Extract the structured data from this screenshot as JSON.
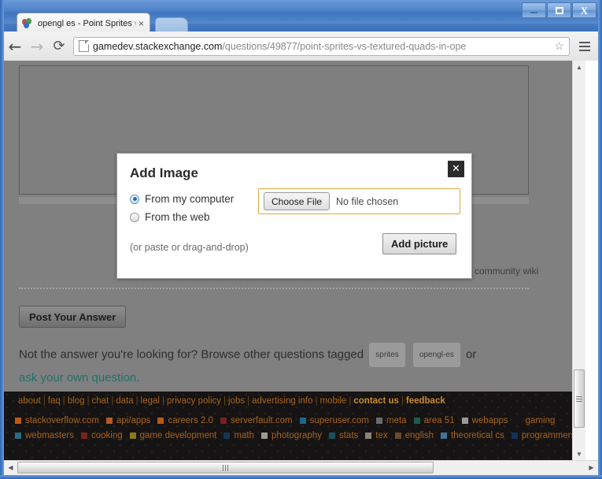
{
  "window": {
    "controls": {
      "minimize": "Minimize",
      "maximize": "Maximize",
      "close": "Close"
    }
  },
  "browser": {
    "tab": {
      "title_main": "opengl es - Point Sprites",
      "title_faded": "v",
      "close_label": "×",
      "favicon": "stack-exchange-balloons-icon"
    },
    "newtab_label": "New Tab",
    "toolbar": {
      "back_label": "←",
      "forward_label": "→",
      "reload_label": "⟳",
      "menu_label": "Menu",
      "star_label": "☆"
    },
    "omnibox": {
      "host": "gamedev.stackexchange.com",
      "path": "/questions/49877/point-sprites-vs-textured-quads-in-ope"
    }
  },
  "page": {
    "community_wiki": "community wiki",
    "post_answer_label": "Post Your Answer",
    "not_answer_prefix": "Not the answer you're looking for? Browse other questions tagged",
    "tags": [
      "sprites",
      "opengl-es"
    ],
    "or_word": "or",
    "ask_own_question": "ask your own question."
  },
  "modal": {
    "title": "Add Image",
    "close_label": "✕",
    "radio_computer": "From my computer",
    "radio_web": "From the web",
    "radio_selected": "From my computer",
    "choose_file_label": "Choose File",
    "no_file_text": "No file chosen",
    "hint": "(or paste or drag-and-drop)",
    "add_picture_label": "Add picture",
    "accent_border": "#e0a83f"
  },
  "footer": {
    "links": [
      "about",
      "faq",
      "blog",
      "chat",
      "data",
      "legal",
      "privacy policy",
      "jobs",
      "advertising info",
      "mobile",
      "contact us",
      "feedback"
    ],
    "bold_links": [
      "contact us",
      "feedback"
    ],
    "separator": "|",
    "sites_row1": [
      {
        "name": "stackoverflow.com",
        "color": "#b8581a"
      },
      {
        "name": "api/apps",
        "color": "#b8581a"
      },
      {
        "name": "careers 2.0",
        "color": "#b8581a"
      },
      {
        "name": "serverfault.com",
        "color": "#7a1f1f"
      },
      {
        "name": "superuser.com",
        "color": "#18698f"
      },
      {
        "name": "meta",
        "color": "#6a6a6a"
      },
      {
        "name": "area 51",
        "color": "#1d5c4c"
      },
      {
        "name": "webapps",
        "color": "#9a9a9a"
      },
      {
        "name": "gaming",
        "color": "transparent"
      }
    ],
    "sites_row2": [
      {
        "name": "webmasters",
        "color": "#2a6b82"
      },
      {
        "name": "cooking",
        "color": "#7a2218"
      },
      {
        "name": "game development",
        "color": "#8a7a1a"
      },
      {
        "name": "math",
        "color": "#15374f"
      },
      {
        "name": "photography",
        "color": "#a09a8f"
      },
      {
        "name": "stats",
        "color": "#13555b"
      },
      {
        "name": "tex",
        "color": "#8a8274"
      },
      {
        "name": "english",
        "color": "#6b4a2a"
      },
      {
        "name": "theoretical cs",
        "color": "#46739c"
      },
      {
        "name": "programmers",
        "color": "#12315c"
      }
    ]
  },
  "scrollbars": {
    "v_up": "▲",
    "v_down": "▼",
    "h_left": "◀",
    "h_right": "▶"
  }
}
